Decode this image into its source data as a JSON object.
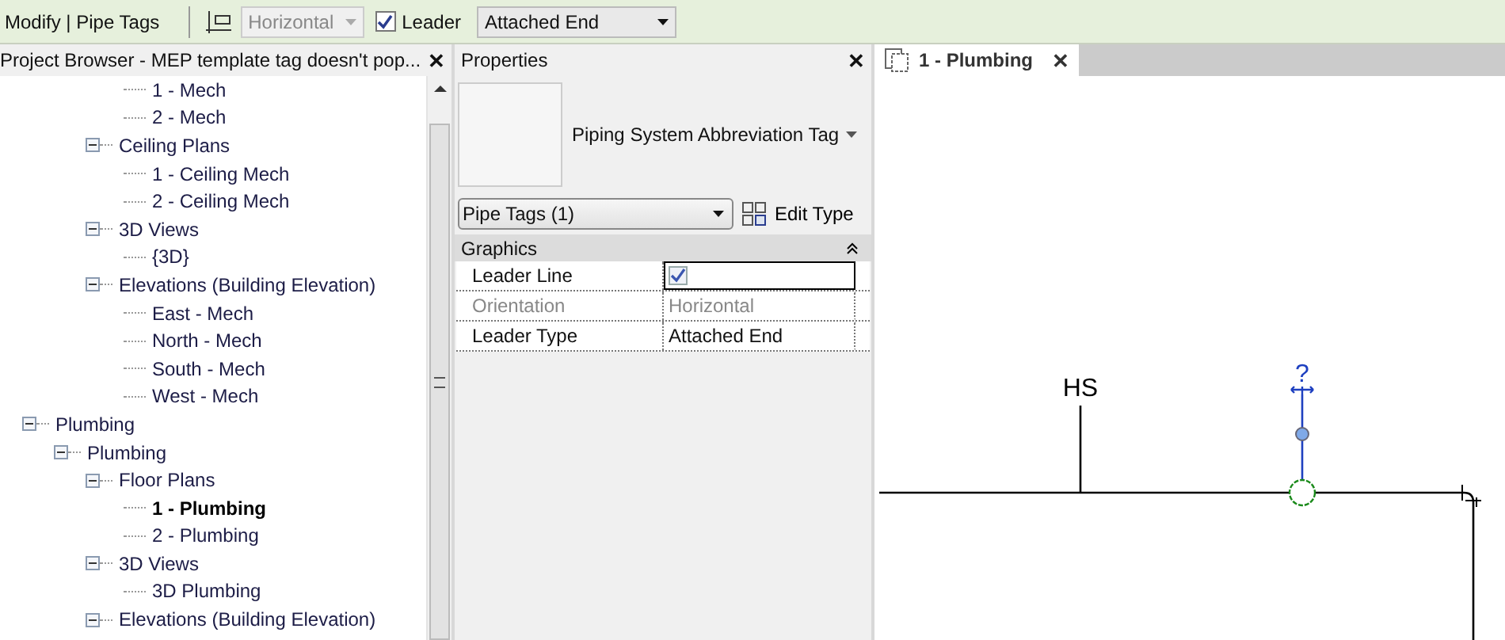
{
  "toolbar": {
    "context": "Modify | Pipe Tags",
    "orientation": {
      "value": "Horizontal",
      "disabled": true
    },
    "leader": {
      "label": "Leader",
      "checked": true
    },
    "leader_type": {
      "value": "Attached End"
    }
  },
  "project_browser": {
    "title": "Project Browser - MEP template tag doesn't pop...",
    "close": "✕",
    "tree": [
      {
        "children": [
          {
            "children": [
              {
                "children": [
                  {
                    "label": "1 - Mech",
                    "active": false
                  },
                  {
                    "label": "2 - Mech",
                    "active": false
                  }
                ]
              },
              {
                "label": "Ceiling Plans",
                "expanded": true,
                "children": [
                  {
                    "label": "1 - Ceiling Mech",
                    "active": false
                  },
                  {
                    "label": "2 - Ceiling Mech",
                    "active": false
                  }
                ]
              },
              {
                "label": "3D Views",
                "expanded": true,
                "children": [
                  {
                    "label": "{3D}",
                    "active": false
                  }
                ]
              },
              {
                "label": "Elevations (Building Elevation)",
                "expanded": true,
                "children": [
                  {
                    "label": "East - Mech",
                    "active": false
                  },
                  {
                    "label": "North - Mech",
                    "active": false
                  },
                  {
                    "label": "South - Mech",
                    "active": false
                  },
                  {
                    "label": "West - Mech",
                    "active": false
                  }
                ]
              }
            ]
          }
        ]
      },
      {
        "label": "Plumbing",
        "expanded": true,
        "children": [
          {
            "label": "Plumbing",
            "expanded": true,
            "children": [
              {
                "label": "Floor Plans",
                "expanded": true,
                "children": [
                  {
                    "label": "1 - Plumbing",
                    "active": true
                  },
                  {
                    "label": "2 - Plumbing",
                    "active": false
                  }
                ]
              },
              {
                "label": "3D Views",
                "expanded": true,
                "children": [
                  {
                    "label": "3D Plumbing",
                    "active": false
                  }
                ]
              },
              {
                "label": "Elevations (Building Elevation)",
                "expanded": true
              }
            ]
          }
        ]
      }
    ]
  },
  "properties": {
    "title": "Properties",
    "close": "✕",
    "type_name": "Piping System Abbreviation Tag",
    "filter": "Pipe Tags (1)",
    "edit_type": "Edit Type",
    "group": {
      "label": "Graphics",
      "expanded": true
    },
    "rows": [
      {
        "kind": "checkbox",
        "label": "Leader Line",
        "checked": true,
        "disabled": false,
        "focused": true
      },
      {
        "kind": "text",
        "label": "Orientation",
        "value": "Horizontal",
        "disabled": true,
        "focused": false
      },
      {
        "kind": "text",
        "label": "Leader Type",
        "value": "Attached End",
        "disabled": false,
        "focused": false
      }
    ]
  },
  "view": {
    "tab": {
      "label": "1 - Plumbing",
      "close": "✕",
      "selected": true
    },
    "tags": [
      {
        "kind": "text",
        "text": "HS"
      },
      {
        "kind": "selected",
        "text": "?"
      }
    ]
  }
}
